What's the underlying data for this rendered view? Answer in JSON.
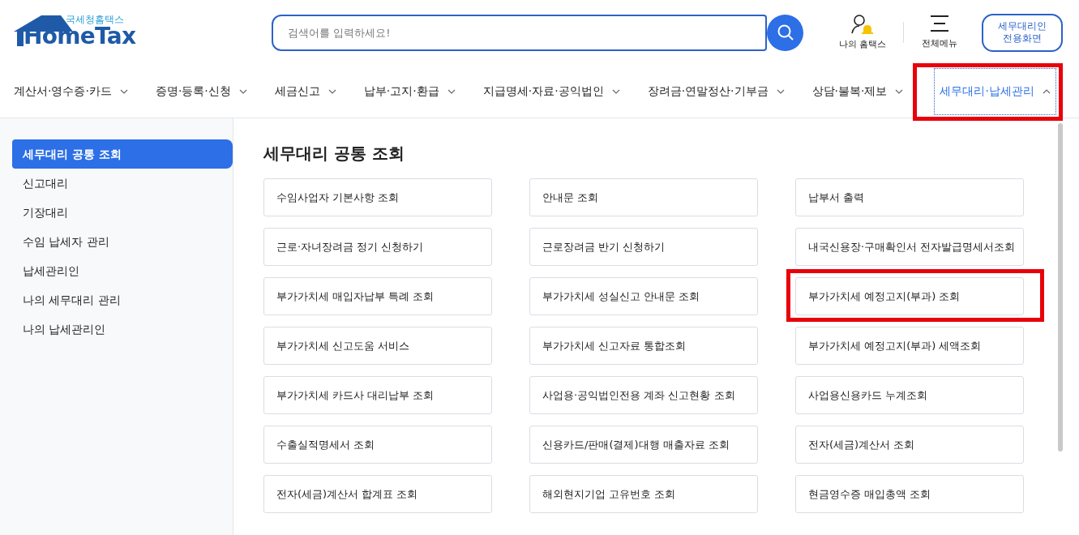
{
  "header": {
    "logo_caption": "국세청홈택스",
    "logo_text": "HomeTax",
    "search": {
      "placeholder": "검색어를 입력하세요!"
    },
    "my_hometax": "나의 홈택스",
    "all_menu": "전체메뉴",
    "agent_button": "세무대리인 전용화면"
  },
  "nav": [
    {
      "label": "계산서·영수증·카드",
      "selected": false,
      "highlighted": false
    },
    {
      "label": "증명·등록·신청",
      "selected": false,
      "highlighted": false
    },
    {
      "label": "세금신고",
      "selected": false,
      "highlighted": false
    },
    {
      "label": "납부·고지·환급",
      "selected": false,
      "highlighted": false
    },
    {
      "label": "지급명세·자료·공익법인",
      "selected": false,
      "highlighted": false
    },
    {
      "label": "장려금·연말정산·기부금",
      "selected": false,
      "highlighted": false
    },
    {
      "label": "상담·불복·제보",
      "selected": false,
      "highlighted": false
    },
    {
      "label": "세무대리·납세관리",
      "selected": true,
      "highlighted": true
    }
  ],
  "sidebar": {
    "items": [
      {
        "label": "세무대리 공통 조회",
        "selected": true
      },
      {
        "label": "신고대리",
        "selected": false
      },
      {
        "label": "기장대리",
        "selected": false
      },
      {
        "label": "수임 납세자 관리",
        "selected": false
      },
      {
        "label": "납세관리인",
        "selected": false
      },
      {
        "label": "나의 세무대리 관리",
        "selected": false
      },
      {
        "label": "나의 납세관리인",
        "selected": false
      }
    ]
  },
  "main": {
    "title": "세무대리 공통 조회",
    "items": [
      {
        "label": "수임사업자 기본사항 조회",
        "highlighted": false
      },
      {
        "label": "안내문 조회",
        "highlighted": false
      },
      {
        "label": "납부서 출력",
        "highlighted": false
      },
      {
        "label": "근로·자녀장려금 정기 신청하기",
        "highlighted": false
      },
      {
        "label": "근로장려금 반기 신청하기",
        "highlighted": false
      },
      {
        "label": "내국신용장·구매확인서 전자발급명세서조회",
        "highlighted": false
      },
      {
        "label": "부가가치세 매입자납부 특례 조회",
        "highlighted": false
      },
      {
        "label": "부가가치세 성실신고 안내문 조회",
        "highlighted": false
      },
      {
        "label": "부가가치세 예정고지(부과) 조회",
        "highlighted": true
      },
      {
        "label": "부가가치세 신고도움 서비스",
        "highlighted": false
      },
      {
        "label": "부가가치세 신고자료 통합조회",
        "highlighted": false
      },
      {
        "label": "부가가치세 예정고지(부과) 세액조회",
        "highlighted": false
      },
      {
        "label": "부가가치세 카드사 대리납부 조회",
        "highlighted": false
      },
      {
        "label": "사업용·공익법인전용 계좌 신고현황 조회",
        "highlighted": false
      },
      {
        "label": "사업용신용카드 누계조회",
        "highlighted": false
      },
      {
        "label": "수출실적명세서 조회",
        "highlighted": false
      },
      {
        "label": "신용카드/판매(결제)대행 매출자료 조회",
        "highlighted": false
      },
      {
        "label": "전자(세금)계산서 조회",
        "highlighted": false
      },
      {
        "label": "전자(세금)계산서 합계표 조회",
        "highlighted": false
      },
      {
        "label": "해외현지기업 고유번호 조회",
        "highlighted": false
      },
      {
        "label": "현금영수증 매입총액 조회",
        "highlighted": false
      }
    ]
  }
}
